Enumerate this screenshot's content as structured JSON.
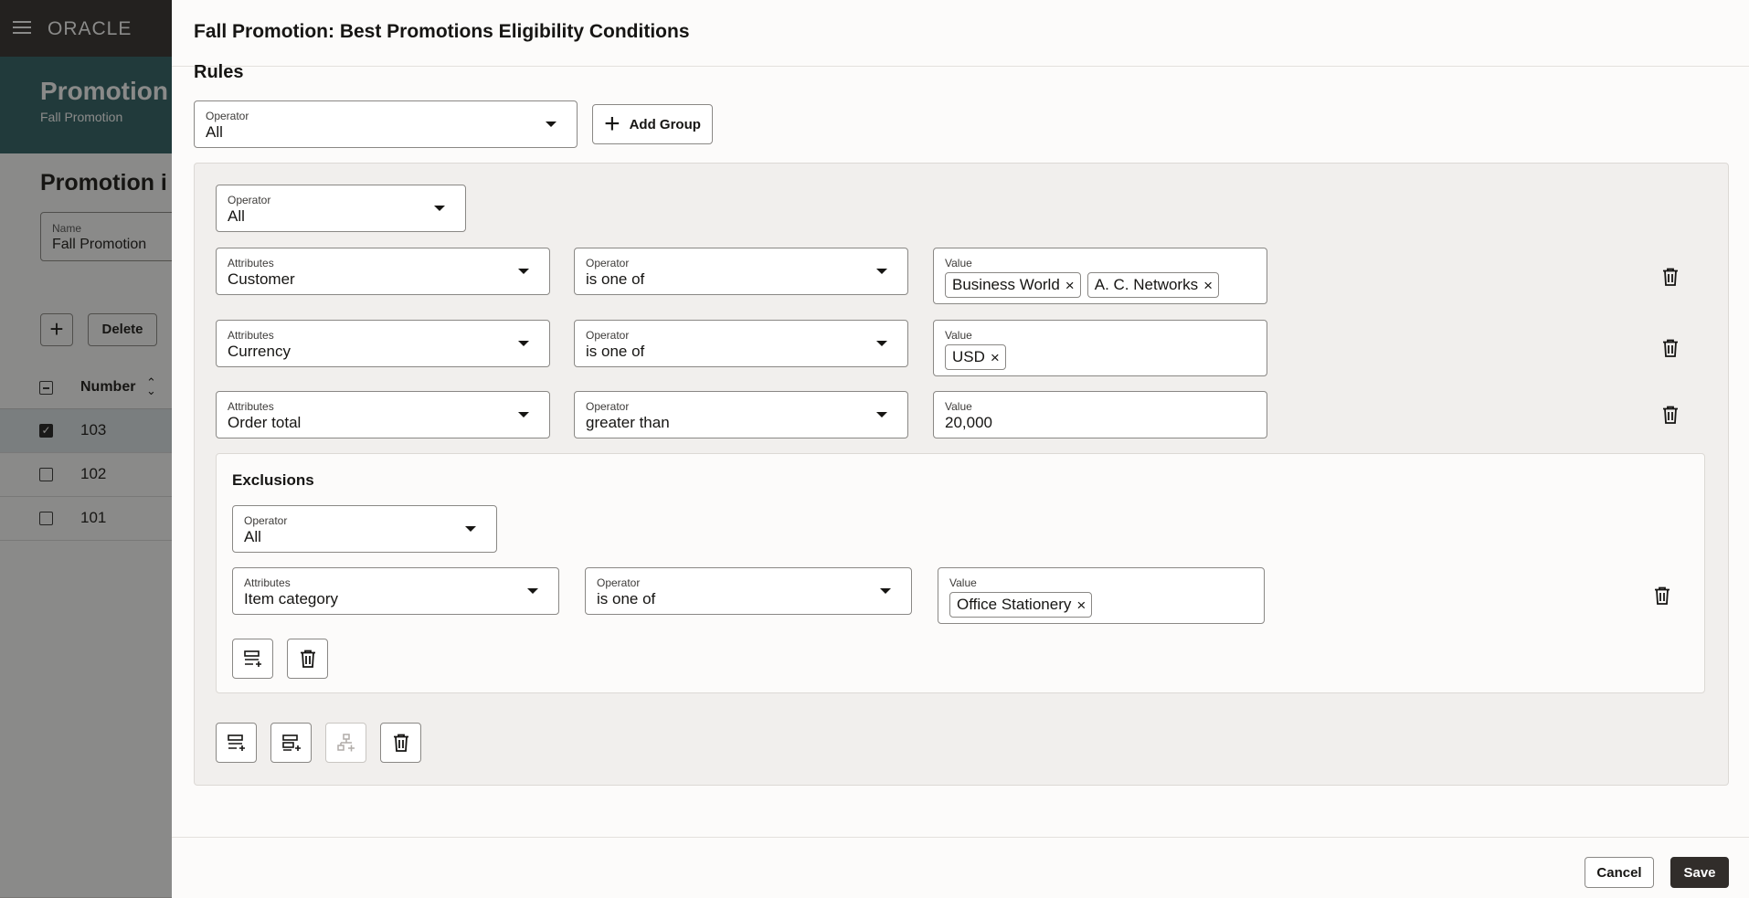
{
  "background": {
    "brand": "ORACLE",
    "hero_title": "Promotion",
    "hero_subtitle": "Fall Promotion",
    "section_title": "Promotion i",
    "name_field": {
      "label": "Name",
      "value": "Fall Promotion"
    },
    "add_label": "+",
    "delete_label": "Delete",
    "table_header": "Number",
    "rows": [
      {
        "number": "103",
        "selected": true
      },
      {
        "number": "102",
        "selected": false
      },
      {
        "number": "101",
        "selected": false
      }
    ]
  },
  "drawer": {
    "title": "Fall Promotion: Best Promotions Eligibility Conditions",
    "rules_title": "Rules",
    "top_operator": {
      "label": "Operator",
      "value": "All"
    },
    "add_group_label": "Add Group",
    "group": {
      "operator": {
        "label": "Operator",
        "value": "All"
      },
      "conditions": [
        {
          "attr_label": "Attributes",
          "attr": "Customer",
          "op_label": "Operator",
          "op": "is one of",
          "value_label": "Value",
          "chips": [
            "Business World",
            "A. C. Networks"
          ]
        },
        {
          "attr_label": "Attributes",
          "attr": "Currency",
          "op_label": "Operator",
          "op": "is one of",
          "value_label": "Value",
          "chips": [
            "USD"
          ]
        },
        {
          "attr_label": "Attributes",
          "attr": "Order total",
          "op_label": "Operator",
          "op": "greater than",
          "value_label": "Value",
          "value": "20,000"
        }
      ],
      "exclusions": {
        "title": "Exclusions",
        "operator": {
          "label": "Operator",
          "value": "All"
        },
        "condition": {
          "attr_label": "Attributes",
          "attr": "Item category",
          "op_label": "Operator",
          "op": "is one of",
          "value_label": "Value",
          "chips": [
            "Office Stationery"
          ]
        }
      }
    },
    "cancel_label": "Cancel",
    "save_label": "Save",
    "icons": {
      "remove": "close-icon",
      "delete": "trash-icon",
      "add_condition": "add-condition-icon",
      "add_exclusion": "add-exclusion-icon",
      "add_subgroup": "add-subgroup-icon",
      "caret": "chevron-down-icon"
    }
  }
}
